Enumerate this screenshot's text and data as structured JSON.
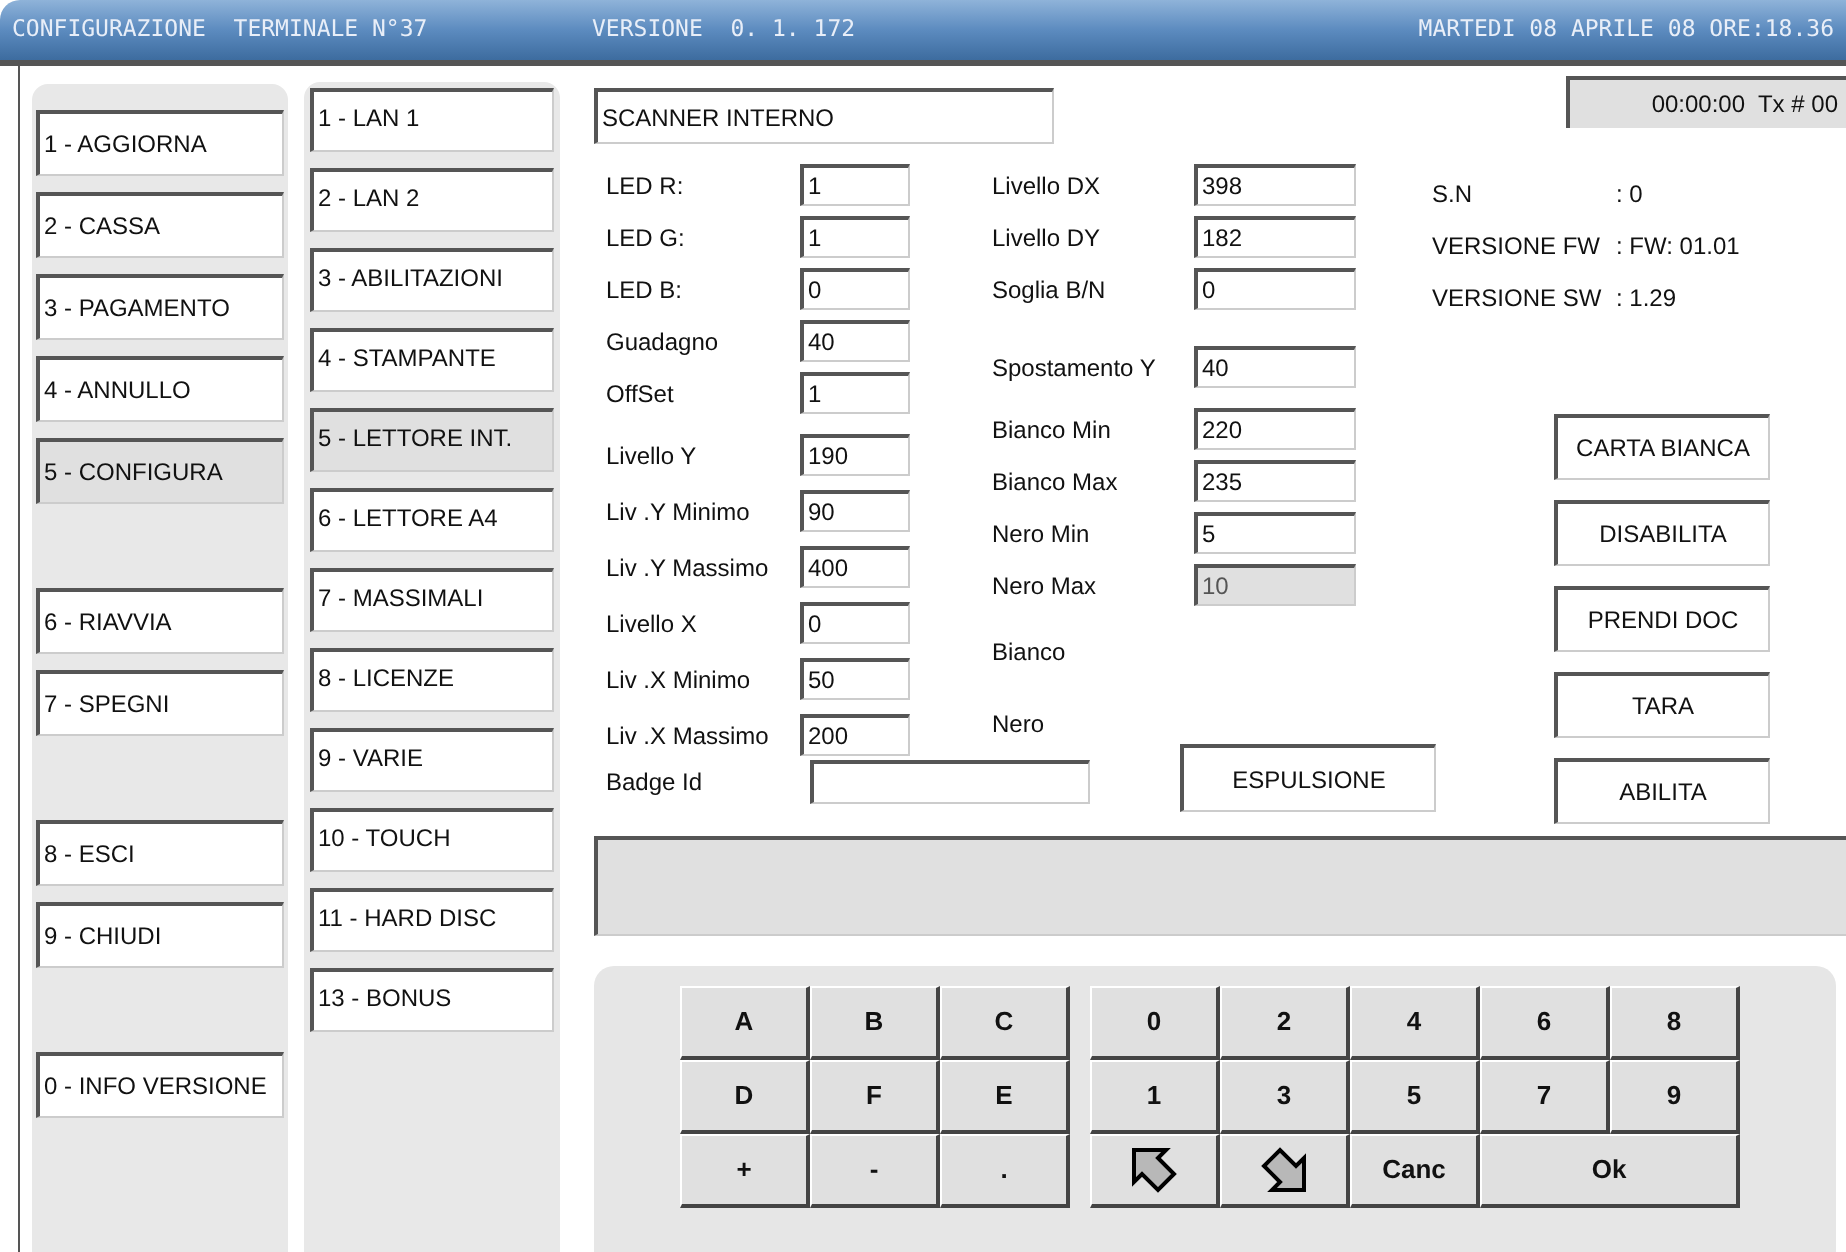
{
  "title_bar": {
    "title": "CONFIGURAZIONE  TERMINALE N°37",
    "version": "VERSIONE  0. 1. 172",
    "datetime": "MARTEDI 08 APRILE 08 ORE:18.36"
  },
  "main_menu": [
    [
      {
        "label": "1 - AGGIORNA",
        "selected": false
      },
      {
        "label": "2 - CASSA",
        "selected": false
      },
      {
        "label": "3 - PAGAMENTO",
        "selected": false
      },
      {
        "label": "4 - ANNULLO",
        "selected": false
      },
      {
        "label": "5 - CONFIGURA",
        "selected": true
      }
    ],
    [
      {
        "label": "6 - RIAVVIA",
        "selected": false
      },
      {
        "label": "7 - SPEGNI",
        "selected": false
      }
    ],
    [
      {
        "label": "8 - ESCI",
        "selected": false
      },
      {
        "label": "9 - CHIUDI",
        "selected": false
      }
    ],
    [
      {
        "label": "0 - INFO VERSIONE",
        "selected": false
      }
    ]
  ],
  "sub_menu": [
    {
      "label": "1 - LAN 1",
      "selected": false
    },
    {
      "label": "2 - LAN 2",
      "selected": false
    },
    {
      "label": "3 - ABILITAZIONI",
      "selected": false
    },
    {
      "label": "4 - STAMPANTE",
      "selected": false
    },
    {
      "label": "5 - LETTORE INT.",
      "selected": true
    },
    {
      "label": "6 - LETTORE A4",
      "selected": false
    },
    {
      "label": "7 - MASSIMALI",
      "selected": false
    },
    {
      "label": "8 - LICENZE",
      "selected": false
    },
    {
      "label": "9 - VARIE",
      "selected": false
    },
    {
      "label": "10 - TOUCH",
      "selected": false
    },
    {
      "label": "11 - HARD DISC",
      "selected": false
    },
    {
      "label": "13 - BONUS",
      "selected": false
    }
  ],
  "device_name": "SCANNER INTERNO",
  "status": "00:00:00  Tx # 00",
  "left_fields": [
    [
      {
        "label": "LED R:",
        "value": "1",
        "disabled": false
      },
      {
        "label": "LED G:",
        "value": "1",
        "disabled": false
      },
      {
        "label": "LED B:",
        "value": "0",
        "disabled": false
      },
      {
        "label": "Guadagno",
        "value": "40",
        "disabled": false
      },
      {
        "label": "OffSet",
        "value": "1",
        "disabled": false
      }
    ],
    [
      {
        "label": "Livello Y",
        "value": "190",
        "disabled": false
      },
      {
        "label": "Liv .Y Minimo",
        "value": "90",
        "disabled": false
      },
      {
        "label": "Liv .Y Massimo",
        "value": "400",
        "disabled": false
      },
      {
        "label": "Livello X",
        "value": "0",
        "disabled": false
      },
      {
        "label": "Liv .X Minimo",
        "value": "50",
        "disabled": false
      },
      {
        "label": "Liv .X Massimo",
        "value": "200",
        "disabled": false
      }
    ]
  ],
  "middle_fields": [
    [
      {
        "kind": "field",
        "label": "Livello DX",
        "value": "398",
        "disabled": false
      },
      {
        "kind": "field",
        "label": "Livello DY",
        "value": "182",
        "disabled": false
      },
      {
        "kind": "field",
        "label": "Soglia B/N",
        "value": "0",
        "disabled": false
      }
    ],
    [
      {
        "kind": "field",
        "label": "Spostamento Y",
        "value": "40",
        "disabled": false
      }
    ],
    [
      {
        "kind": "field",
        "label": "Bianco Min",
        "value": "220",
        "disabled": false
      },
      {
        "kind": "field",
        "label": "Bianco Max",
        "value": "235",
        "disabled": false
      },
      {
        "kind": "field",
        "label": "Nero Min",
        "value": "5",
        "disabled": false
      },
      {
        "kind": "field",
        "label": "Nero Max",
        "value": "10",
        "disabled": true
      }
    ],
    [
      {
        "kind": "label",
        "label": "Bianco"
      },
      {
        "kind": "label",
        "label": "Nero"
      }
    ]
  ],
  "info": [
    {
      "label": "S.N",
      "value": ": 0"
    },
    {
      "label": "VERSIONE FW",
      "value": ": FW: 01.01"
    },
    {
      "label": "VERSIONE SW",
      "value": ": 1.29"
    }
  ],
  "actions": [
    "CARTA BIANCA",
    "DISABILITA",
    "PRENDI DOC",
    "TARA",
    "ABILITA"
  ],
  "badge": {
    "label": "Badge Id"
  },
  "eject_button": "ESPULSIONE",
  "keypad": {
    "left": [
      {
        "kind": "text",
        "label": "A"
      },
      {
        "kind": "text",
        "label": "B"
      },
      {
        "kind": "text",
        "label": "C"
      },
      {
        "kind": "text",
        "label": "D"
      },
      {
        "kind": "text",
        "label": "F"
      },
      {
        "kind": "text",
        "label": "E"
      },
      {
        "kind": "text",
        "label": "+"
      },
      {
        "kind": "text",
        "label": "-"
      },
      {
        "kind": "text",
        "label": "."
      }
    ],
    "right": [
      {
        "kind": "text",
        "label": "0"
      },
      {
        "kind": "text",
        "label": "2"
      },
      {
        "kind": "text",
        "label": "4"
      },
      {
        "kind": "text",
        "label": "6"
      },
      {
        "kind": "text",
        "label": "8"
      },
      {
        "kind": "text",
        "label": "1"
      },
      {
        "kind": "text",
        "label": "3"
      },
      {
        "kind": "text",
        "label": "5"
      },
      {
        "kind": "text",
        "label": "7"
      },
      {
        "kind": "text",
        "label": "9"
      },
      {
        "kind": "forward"
      },
      {
        "kind": "back"
      },
      {
        "kind": "text",
        "label": "Canc"
      },
      {
        "kind": "wide",
        "label": "Ok"
      }
    ]
  }
}
